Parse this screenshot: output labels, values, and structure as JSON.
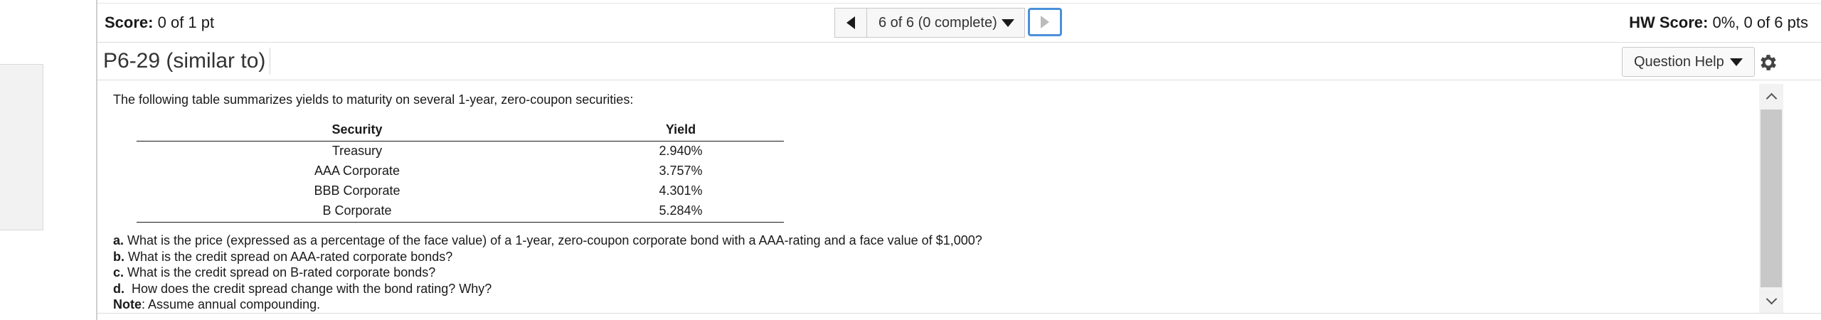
{
  "header": {
    "score_label": "Score:",
    "score_value": "0 of 1 pt",
    "nav_select": "6 of 6 (0 complete)",
    "hw_score_label": "HW Score:",
    "hw_score_value": "0%, 0 of 6 pts"
  },
  "question": {
    "title": "P6-29 (similar to)",
    "help_label": "Question Help"
  },
  "content": {
    "intro": "The following table summarizes yields to maturity on several 1-year, zero-coupon securities:",
    "table": {
      "headers": [
        "Security",
        "Yield"
      ],
      "rows": [
        [
          "Treasury",
          "2.940%"
        ],
        [
          "AAA Corporate",
          "3.757%"
        ],
        [
          "BBB Corporate",
          "4.301%"
        ],
        [
          "B Corporate",
          "5.284%"
        ]
      ]
    },
    "questions": [
      {
        "label": "a.",
        "text": " What is the price (expressed as a percentage of the face value) of a 1-year, zero-coupon corporate bond with a AAA-rating and a face value of $1,000?"
      },
      {
        "label": "b.",
        "text": " What is the credit spread on AAA-rated corporate bonds?"
      },
      {
        "label": "c.",
        "text": " What is the credit spread on B-rated corporate bonds?"
      },
      {
        "label": "d.",
        "text": "  How does the credit spread change with the bond rating? Why?"
      },
      {
        "label": "Note",
        "text": ": Assume annual compounding."
      }
    ]
  },
  "icons": {
    "prev": "triangle-left-icon",
    "next": "triangle-right-icon",
    "dropdown": "triangle-down-icon",
    "settings": "gear-icon"
  },
  "colors": {
    "focus_border": "#4a90d9",
    "scroll_thumb": "#c8c8c8"
  }
}
